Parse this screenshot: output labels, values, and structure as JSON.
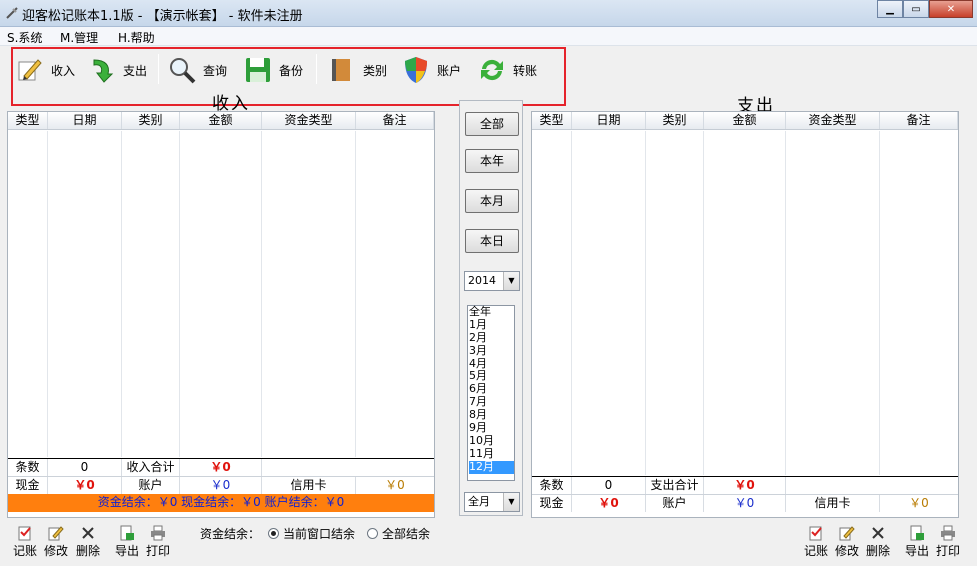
{
  "window": {
    "title": "迎客松记账本1.1版 - 【演示帐套】 - 软件未注册"
  },
  "menu": [
    {
      "label": "S.系统"
    },
    {
      "label": "M.管理"
    },
    {
      "label": "H.帮助"
    }
  ],
  "toolbar": [
    {
      "label": "收入",
      "icon": "income-pencil-icon"
    },
    {
      "label": "支出",
      "icon": "expense-arrow-icon"
    },
    {
      "label": "查询",
      "icon": "magnifier-icon"
    },
    {
      "label": "备份",
      "icon": "floppy-disk-icon"
    },
    {
      "label": "类别",
      "icon": "book-icon"
    },
    {
      "label": "账户",
      "icon": "shield-icon"
    },
    {
      "label": "转账",
      "icon": "refresh-arrows-icon"
    }
  ],
  "income": {
    "title": "收入",
    "columns": [
      "类型",
      "日期",
      "类别",
      "金额",
      "资金类型",
      "备注"
    ],
    "summary": {
      "count_label": "条数",
      "count": "0",
      "total_label": "收入合计",
      "total": "￥0"
    },
    "accounts": {
      "cash_label": "现金",
      "cash": "￥0",
      "account_label": "账户",
      "account": "￥0",
      "credit_label": "信用卡",
      "credit": "￥0"
    },
    "balance_text": "资金结余：￥0  现金结余：￥0  账户结余：￥0"
  },
  "expense": {
    "title": "支出",
    "columns": [
      "类型",
      "日期",
      "类别",
      "金额",
      "资金类型",
      "备注"
    ],
    "summary": {
      "count_label": "条数",
      "count": "0",
      "total_label": "支出合计",
      "total": "￥0"
    },
    "accounts": {
      "cash_label": "现金",
      "cash": "￥0",
      "account_label": "账户",
      "account": "￥0",
      "credit_label": "信用卡",
      "credit": "￥0"
    }
  },
  "filters": {
    "buttons": [
      "全部",
      "本年",
      "本月",
      "本日"
    ],
    "year": "2014",
    "months": [
      "全年",
      "1月",
      "2月",
      "3月",
      "4月",
      "5月",
      "6月",
      "7月",
      "8月",
      "9月",
      "10月",
      "11月",
      "12月"
    ],
    "selected_month": "12月",
    "range": "全月"
  },
  "bottom": {
    "left_buttons": [
      "记账",
      "修改",
      "删除",
      "导出",
      "打印"
    ],
    "right_buttons": [
      "记账",
      "修改",
      "删除",
      "导出",
      "打印"
    ],
    "balance_label": "资金结余：",
    "options": [
      "当前窗口结余",
      "全部结余"
    ],
    "selected_option": "当前窗口结余"
  },
  "colors": {
    "highlight_border": "#e5232b",
    "balance_bar": "#ff7f0e",
    "amount_red": "#e0120c",
    "amount_blue": "#1a2dcc"
  }
}
